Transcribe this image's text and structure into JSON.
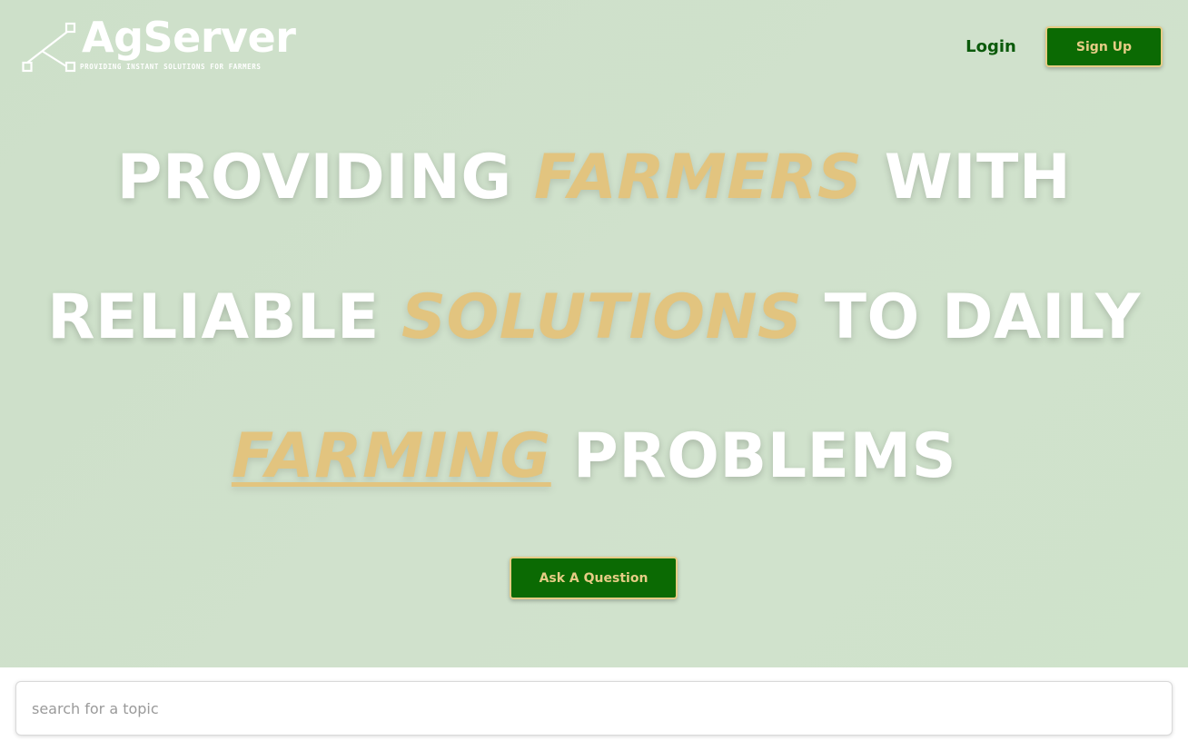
{
  "brand": {
    "name": "AgServer",
    "tagline": "PROVIDING INSTANT SOLUTIONS FOR FARMERS",
    "logo_icon": "network-nodes-icon"
  },
  "nav": {
    "login_label": "Login",
    "signup_label": "Sign Up"
  },
  "hero": {
    "line1": {
      "w1": "PROVIDING",
      "a1": "FARMERS",
      "w2": "WITH"
    },
    "line2": {
      "w1": "RELIABLE",
      "a1": "SOLUTIONS",
      "w2": "TO DAILY"
    },
    "line3": {
      "a1": "FARMING",
      "w1": "PROBLEMS"
    },
    "cta_label": "Ask A Question"
  },
  "search": {
    "placeholder": "search for a topic",
    "value": ""
  },
  "colors": {
    "hero_bg": "#cde0c9",
    "accent_green": "#0b6a03",
    "accent_gold": "#e2c47f",
    "login_green": "#0b5a0b"
  }
}
